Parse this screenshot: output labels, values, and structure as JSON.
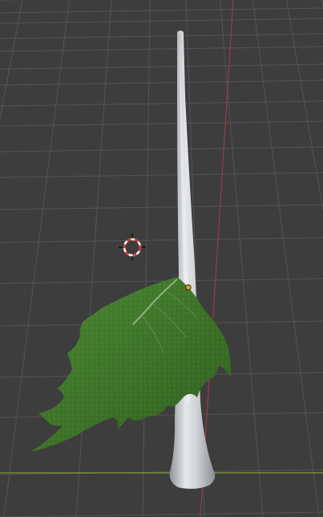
{
  "viewport": {
    "name": "3D Viewport",
    "background_color": "#3d3d3d",
    "grid_color": "#545454",
    "x_axis_color": "#7f9a3a",
    "y_axis_color": "#9e3b44"
  },
  "scene": {
    "objects": [
      {
        "name": "stem",
        "icon": "tapered-cylinder-mesh",
        "color": "#c9ccd0"
      },
      {
        "name": "leaf",
        "icon": "leaf-mesh",
        "color": "#3f7a2a"
      }
    ],
    "origin_color": "#e8a020",
    "cursor_icon": "3d-cursor-icon"
  }
}
